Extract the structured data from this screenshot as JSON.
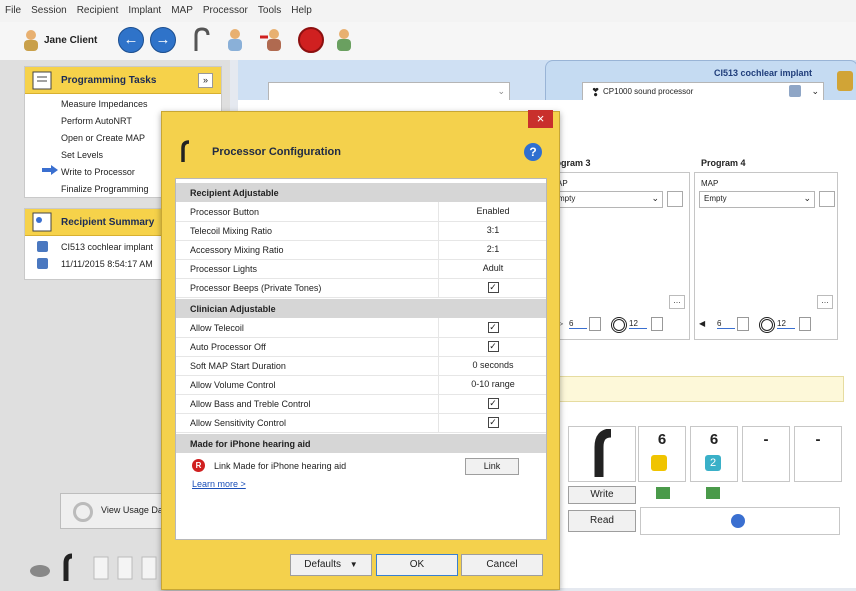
{
  "menu": [
    "File",
    "Session",
    "Recipient",
    "Implant",
    "MAP",
    "Processor",
    "Tools",
    "Help"
  ],
  "toolbar": {
    "user": "Jane Client"
  },
  "tasks": {
    "title": "Programming Tasks",
    "items": [
      "Measure Impedances",
      "Perform AutoNRT",
      "Open or Create MAP",
      "Set Levels",
      "Write to Processor",
      "Finalize Programming"
    ]
  },
  "summary": {
    "title": "Recipient Summary",
    "implant": "CI513 cochlear implant",
    "datetime": "11/11/2015 8:54:17 AM"
  },
  "usage": {
    "label": "View Usage Da"
  },
  "implant_tab": {
    "title": "CI513 cochlear implant",
    "processor": "CP1000 sound processor"
  },
  "programs": [
    {
      "title": "rogram 3",
      "map_label": "AP",
      "map_value": "mpty",
      "vol": "6",
      "sens": "12"
    },
    {
      "title": "Program 4",
      "map_label": "MAP",
      "map_value": "Empty",
      "vol": "6",
      "sens": "12"
    }
  ],
  "cards": {
    "n1": "6",
    "n2": "6",
    "n3": "-",
    "n4": "-",
    "write": "Write",
    "read": "Read",
    "badge": "2"
  },
  "dialog": {
    "title": "Processor Configuration",
    "sections": [
      {
        "title": "Recipient Adjustable",
        "rows": [
          {
            "label": "Processor Button",
            "value": "Enabled"
          },
          {
            "label": "Telecoil Mixing Ratio",
            "value": "3:1"
          },
          {
            "label": "Accessory Mixing Ratio",
            "value": "2:1"
          },
          {
            "label": "Processor Lights",
            "value": "Adult"
          },
          {
            "label": "Processor Beeps (Private Tones)",
            "value": ""
          }
        ]
      },
      {
        "title": "Clinician Adjustable",
        "rows": [
          {
            "label": "Allow Telecoil",
            "value": ""
          },
          {
            "label": "Auto Processor Off",
            "value": ""
          },
          {
            "label": "Soft MAP Start Duration",
            "value": "0 seconds"
          },
          {
            "label": "Allow Volume Control",
            "value": "0-10 range"
          },
          {
            "label": "Allow Bass and Treble Control",
            "value": ""
          },
          {
            "label": "Allow Sensitivity Control",
            "value": ""
          }
        ]
      },
      {
        "title": "Made for iPhone hearing aid",
        "rows": []
      }
    ],
    "mfi_badge": "R",
    "mfi_label": "Link Made for iPhone hearing aid",
    "mfi_button": "Link",
    "learn_more": "Learn more >",
    "defaults": "Defaults",
    "ok": "OK",
    "cancel": "Cancel",
    "close": "×"
  },
  "colors": {
    "accent": "#f4d14c",
    "brand_blue": "#2f73c9",
    "stop_red": "#d02020"
  },
  "icons": [
    "user-icon",
    "back-icon",
    "forward-icon",
    "processor-icon",
    "users-icon",
    "stop-icon",
    "help-icon",
    "checkbox-icon"
  ]
}
